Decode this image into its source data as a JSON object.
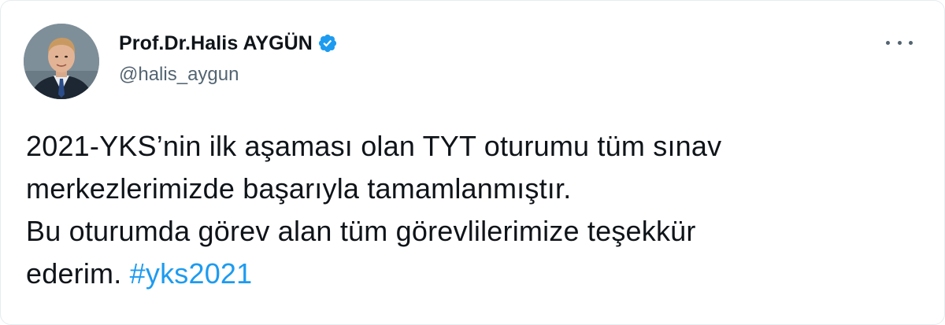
{
  "author": {
    "display_name": "Prof.Dr.Halis AYGÜN",
    "handle": "@halis_aygun",
    "verified": true,
    "avatar_icon": "profile-photo"
  },
  "menu": {
    "icon": "more-horizontal-icon"
  },
  "tweet": {
    "lines": [
      "2021-YKS’nin ilk aşaması olan TYT oturumu tüm sınav",
      "merkezlerimizde başarıyla tamamlanmıştır.",
      "Bu oturumda görev alan tüm görevlilerimize teşekkür"
    ],
    "last_line_text": "ederim.",
    "hashtag": "#yks2021"
  },
  "colors": {
    "text": "#0f1419",
    "secondary": "#536471",
    "link": "#1d9bf0",
    "verified_badge": "#1d9bf0"
  }
}
